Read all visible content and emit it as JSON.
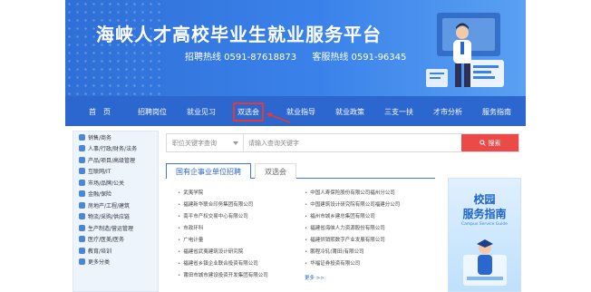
{
  "banner": {
    "title": "海峡人才高校毕业生就业服务平台",
    "hotline_recruit": "招聘热线  0591-87618873",
    "hotline_service": "客服热线  0591-96345"
  },
  "nav": {
    "items": [
      "首　页",
      "招聘岗位",
      "就业见习",
      "双选会",
      "就业指导",
      "就业政策",
      "三支一扶",
      "才市分析",
      "服务指南"
    ],
    "active": "双选会"
  },
  "sidebar": {
    "items": [
      "销售/商务",
      "人事/行政/财务/法务",
      "产品/项目/高级管理",
      "互联网/IT",
      "市场/品牌/公关",
      "金融/保险",
      "房地产/工程/建筑",
      "物流/采购/供应链",
      "生产制造/营运管理",
      "医疗/医美/医务",
      "教育/培训",
      "更多分类"
    ]
  },
  "search": {
    "category_placeholder": "职位关键字查询",
    "input_placeholder": "请输入查询关键字",
    "button_label": "搜索"
  },
  "tabs": [
    {
      "label": "国有企事业单位招聘",
      "active": true
    },
    {
      "label": "双选会",
      "active": false
    }
  ],
  "postings": {
    "left": [
      "武夷学院",
      "福建新华联合印务集团有限公司",
      "南平市产权交易中心有限公司",
      "市政环科",
      "广电计量",
      "福建省武夷建筑设计研究院",
      "福建省乡镇企业联合投资有限公司",
      "莆田市城市建设投资开发集团有限公司"
    ],
    "right": [
      "中国人寿保险股份有限公司福州分公司",
      "中国建筑设计研究院有限公司福建分公司",
      "福州市城乡建总集团有限公司",
      "福建省海峡人力资源股份有限公司",
      "福建供销熙数字产业发展有限公司",
      "鹏程冷轧(莆田)有限公司",
      "华福证券投资有限公司"
    ],
    "more_label": "更多 >>"
  },
  "guide": {
    "title_1": "校园",
    "title_2": "服务指南",
    "subtitle": "Campus Service Guide"
  },
  "colors": {
    "nav_bg": "#2c66cf",
    "accent_red": "#ec4a48",
    "highlight_red": "#e53935",
    "tab_active": "#2c66cf"
  }
}
